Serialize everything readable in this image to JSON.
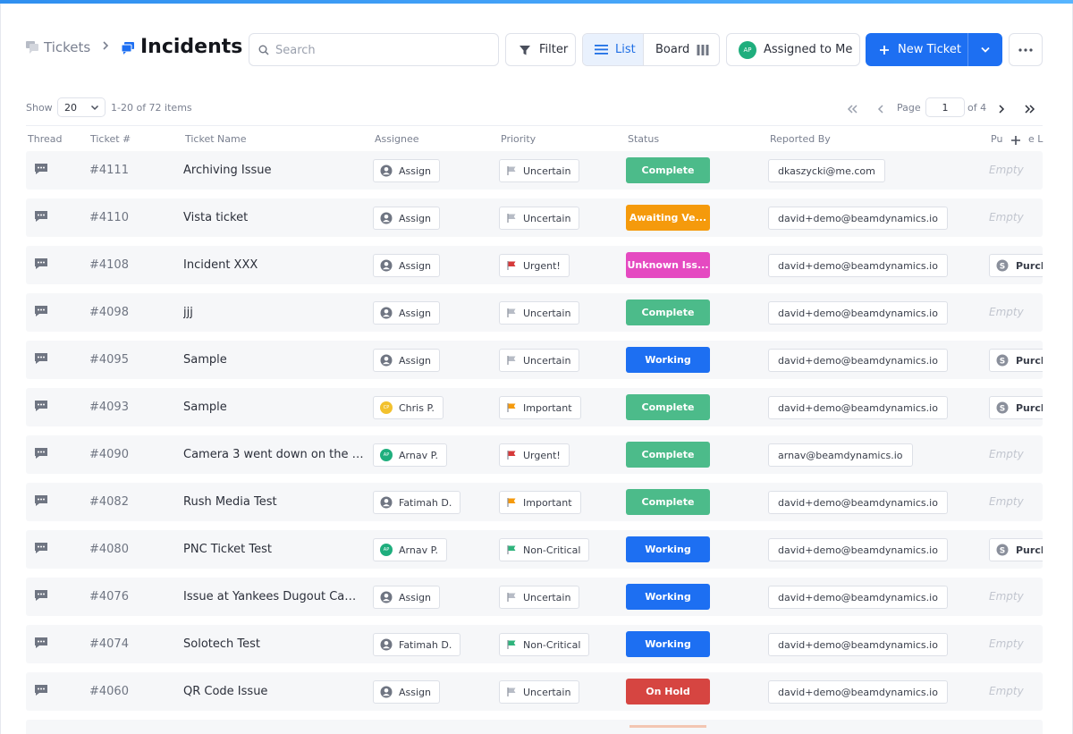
{
  "breadcrumb": {
    "parent": "Tickets",
    "separator": ">",
    "current": "Incidents"
  },
  "search": {
    "placeholder": "Search",
    "value": ""
  },
  "toolbar": {
    "filter_label": "Filter",
    "list_label": "List",
    "board_label": "Board",
    "assigned_label": "Assigned to Me",
    "assigned_initials": "AP",
    "new_ticket_label": "New Ticket"
  },
  "pagination": {
    "show_label": "Show",
    "per_page": "20",
    "range_text": "1-20 of 72 items",
    "page_label": "Page",
    "page_value": "1",
    "of_label": "of 4"
  },
  "columns": [
    "Thread",
    "Ticket #",
    "Ticket Name",
    "Assignee",
    "Priority",
    "Status",
    "Reported By",
    "Pu",
    "e L"
  ],
  "colors": {
    "accent": "#1d6ff2",
    "status_complete": "#4cbb8a",
    "status_awaiting": "#f59a0c",
    "status_unknown": "#e54ac1",
    "status_working": "#1d6ff2",
    "status_onhold": "#d64541",
    "flag_uncertain": "#b7bcc6",
    "flag_urgent": "#d63a3a",
    "flag_important": "#f59a0c",
    "flag_noncritical": "#2fb47c"
  },
  "rows": [
    {
      "id": "#4111",
      "name": "Archiving Issue",
      "assignee": "Assign",
      "assignee_type": "empty",
      "priority": "Uncertain",
      "priority_key": "uncertain",
      "status": "Complete",
      "status_key": "complete",
      "reporter": "dkaszycki@me.com",
      "extra": "Empty",
      "extra_type": "empty"
    },
    {
      "id": "#4110",
      "name": "Vista ticket",
      "assignee": "Assign",
      "assignee_type": "empty",
      "priority": "Uncertain",
      "priority_key": "uncertain",
      "status": "Awaiting Ve...",
      "status_key": "awaiting",
      "reporter": "david+demo@beamdynamics.io",
      "extra": "Empty",
      "extra_type": "empty"
    },
    {
      "id": "#4108",
      "name": "Incident XXX",
      "assignee": "Assign",
      "assignee_type": "empty",
      "priority": "Urgent!",
      "priority_key": "urgent",
      "status": "Unknown Iss...",
      "status_key": "unknown",
      "reporter": "david+demo@beamdynamics.io",
      "extra": "Purch",
      "extra_type": "chip"
    },
    {
      "id": "#4098",
      "name": "jjj",
      "assignee": "Assign",
      "assignee_type": "empty",
      "priority": "Uncertain",
      "priority_key": "uncertain",
      "status": "Complete",
      "status_key": "complete",
      "reporter": "david+demo@beamdynamics.io",
      "extra": "Empty",
      "extra_type": "empty"
    },
    {
      "id": "#4095",
      "name": "Sample",
      "assignee": "Assign",
      "assignee_type": "empty",
      "priority": "Uncertain",
      "priority_key": "uncertain",
      "status": "Working",
      "status_key": "working",
      "reporter": "david+demo@beamdynamics.io",
      "extra": "Purch",
      "extra_type": "chip"
    },
    {
      "id": "#4093",
      "name": "Sample",
      "assignee": "Chris P.",
      "assignee_type": "yellow",
      "initials": "CP",
      "priority": "Important",
      "priority_key": "important",
      "status": "Complete",
      "status_key": "complete",
      "reporter": "david+demo@beamdynamics.io",
      "extra": "Purch",
      "extra_type": "chip"
    },
    {
      "id": "#4090",
      "name": "Camera 3 went down on the la...",
      "assignee": "Arnav P.",
      "assignee_type": "green",
      "initials": "AP",
      "priority": "Urgent!",
      "priority_key": "urgent",
      "status": "Complete",
      "status_key": "complete",
      "reporter": "arnav@beamdynamics.io",
      "extra": "Empty",
      "extra_type": "empty"
    },
    {
      "id": "#4082",
      "name": "Rush Media Test",
      "assignee": "Fatimah D.",
      "assignee_type": "person",
      "priority": "Important",
      "priority_key": "important",
      "status": "Complete",
      "status_key": "complete",
      "reporter": "david+demo@beamdynamics.io",
      "extra": "Empty",
      "extra_type": "empty"
    },
    {
      "id": "#4080",
      "name": "PNC Ticket Test",
      "assignee": "Arnav P.",
      "assignee_type": "green",
      "initials": "AP",
      "priority": "Non-Critical",
      "priority_key": "noncritical",
      "status": "Working",
      "status_key": "working",
      "reporter": "david+demo@beamdynamics.io",
      "extra": "Purch",
      "extra_type": "chip"
    },
    {
      "id": "#4076",
      "name": "Issue at Yankees Dugout Came...",
      "assignee": "Assign",
      "assignee_type": "empty",
      "priority": "Uncertain",
      "priority_key": "uncertain",
      "status": "Working",
      "status_key": "working",
      "reporter": "david+demo@beamdynamics.io",
      "extra": "Empty",
      "extra_type": "empty"
    },
    {
      "id": "#4074",
      "name": "Solotech Test",
      "assignee": "Fatimah D.",
      "assignee_type": "person",
      "priority": "Non-Critical",
      "priority_key": "noncritical",
      "status": "Working",
      "status_key": "working",
      "reporter": "david+demo@beamdynamics.io",
      "extra": "Empty",
      "extra_type": "empty"
    },
    {
      "id": "#4060",
      "name": "QR Code Issue",
      "assignee": "Assign",
      "assignee_type": "empty",
      "priority": "Uncertain",
      "priority_key": "uncertain",
      "status": "On Hold",
      "status_key": "onhold",
      "reporter": "david+demo@beamdynamics.io",
      "extra": "Empty",
      "extra_type": "empty"
    }
  ]
}
